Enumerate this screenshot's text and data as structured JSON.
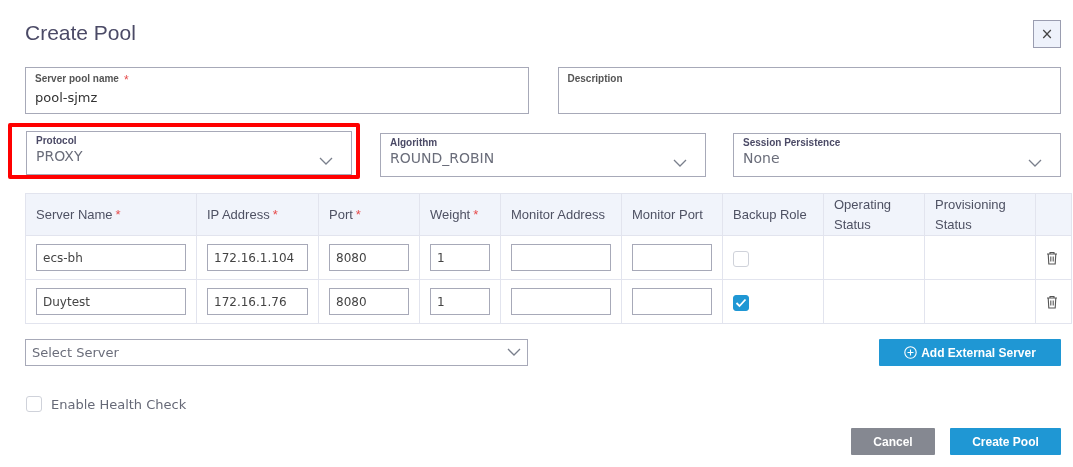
{
  "dialog": {
    "title": "Create Pool",
    "close": "×"
  },
  "fields": [
    {
      "kind": "text",
      "label": "Server pool name",
      "mark": "*",
      "value": "pool-sjmz",
      "highlighted": false
    },
    {
      "kind": "text",
      "label": "Description",
      "highlighted": false
    },
    {
      "kind": "select",
      "label": "Protocol",
      "value": "PROXY",
      "highlighted": true
    },
    {
      "kind": "select",
      "label": "Algorithm",
      "value": "ROUND_ROBIN",
      "highlighted": false
    },
    {
      "kind": "select",
      "label": "Session Persistence",
      "value": "None",
      "highlighted": false
    }
  ],
  "table": {
    "columns": [
      {
        "label": "Server Name",
        "mark": "*"
      },
      {
        "label": "IP Address",
        "mark": "*"
      },
      {
        "label": "Port",
        "mark": "*"
      },
      {
        "label": "Weight",
        "mark": "*"
      },
      {
        "label": "Monitor Address"
      },
      {
        "label": "Monitor Port"
      },
      {
        "label": "Backup Role"
      },
      {
        "label": "Operating Status"
      },
      {
        "label": "Provisioning Status"
      }
    ],
    "rows": [
      {
        "server_name": "ecs-bh",
        "ip_address": "172.16.1.104",
        "port": "8080",
        "weight": "1",
        "backup_role": false
      },
      {
        "server_name": "Duytest",
        "ip_address": "172.16.1.76",
        "port": "8080",
        "weight": "1",
        "backup_role": true
      }
    ]
  },
  "server_select": {
    "placeholder": "Select Server"
  },
  "add_button": "Add External Server",
  "health_check": {
    "label": "Enable Health Check",
    "checked": false
  },
  "buttons": [
    {
      "kind": "secondary",
      "label": "Cancel"
    },
    {
      "kind": "primary",
      "label": "Create Pool"
    }
  ]
}
